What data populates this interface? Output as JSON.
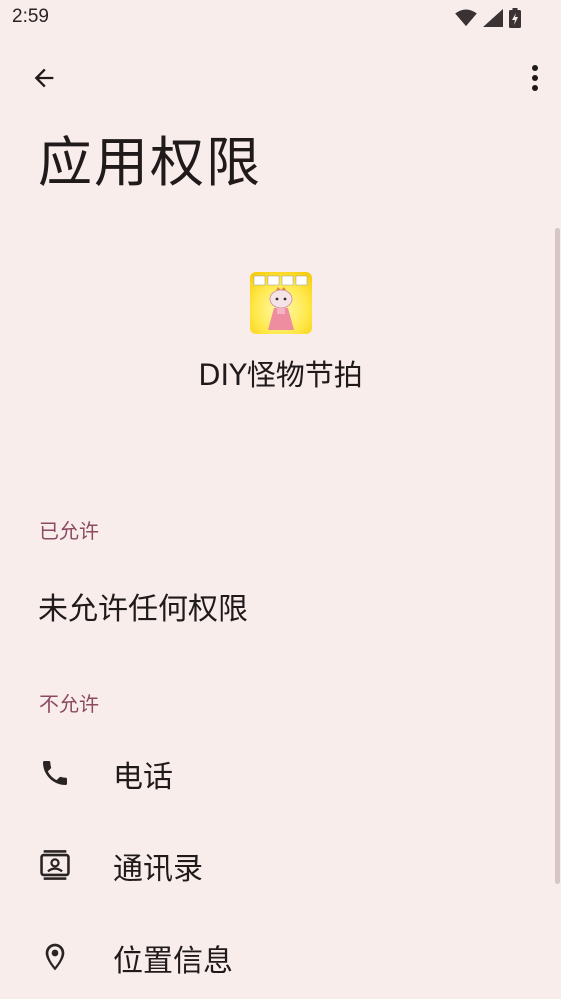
{
  "status_bar": {
    "time": "2:59",
    "icons": [
      "wifi-icon",
      "signal-icon",
      "battery-charging-icon"
    ]
  },
  "toolbar": {
    "back_icon": "arrow-back-icon",
    "more_icon": "more-vert-icon"
  },
  "page": {
    "title": "应用权限"
  },
  "app": {
    "name": "DIY怪物节拍",
    "icon": "app-icon"
  },
  "sections": {
    "allowed": {
      "label": "已允许",
      "empty_text": "未允许任何权限"
    },
    "denied": {
      "label": "不允许",
      "items": [
        {
          "label": "电话",
          "icon": "phone-icon"
        },
        {
          "label": "通讯录",
          "icon": "contacts-icon"
        },
        {
          "label": "位置信息",
          "icon": "location-icon"
        }
      ]
    }
  },
  "colors": {
    "background": "#f9edec",
    "section_label": "#8b4a62",
    "text": "#201a1b",
    "icon": "#2a2324"
  }
}
